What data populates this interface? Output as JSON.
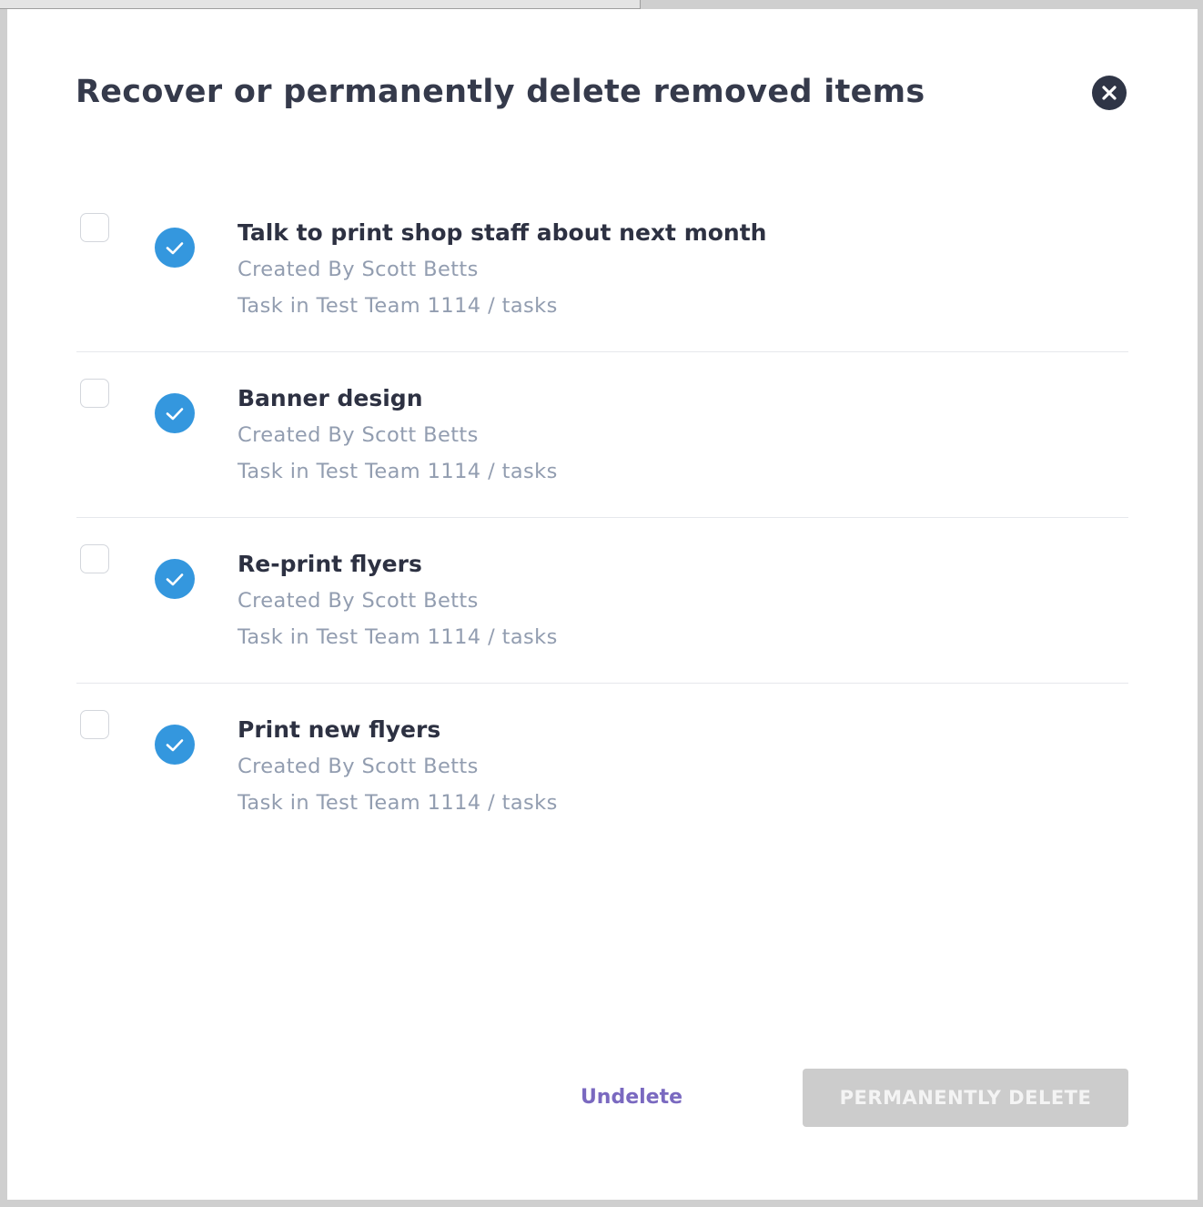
{
  "dialog": {
    "title": "Recover or permanently delete removed items",
    "close_icon": "close-icon"
  },
  "items": [
    {
      "title": "Talk to print shop staff about next month",
      "created_by": "Created By Scott Betts",
      "location": "Task in Test Team 1114 / tasks",
      "selected": false,
      "status": "completed"
    },
    {
      "title": "Banner design",
      "created_by": "Created By Scott Betts",
      "location": "Task in Test Team 1114 / tasks",
      "selected": false,
      "status": "completed"
    },
    {
      "title": "Re-print flyers",
      "created_by": "Created By Scott Betts",
      "location": "Task in Test Team 1114 / tasks",
      "selected": false,
      "status": "completed"
    },
    {
      "title": "Print new flyers",
      "created_by": "Created By Scott Betts",
      "location": "Task in Test Team 1114 / tasks",
      "selected": false,
      "status": "completed"
    }
  ],
  "actions": {
    "undelete_label": "Undelete",
    "permanently_delete_label": "PERMANENTLY DELETE",
    "permanently_delete_enabled": false
  },
  "colors": {
    "title": "#353a4b",
    "meta_text": "#929db0",
    "status_completed": "#3497de",
    "undelete": "#7a69c0",
    "disabled_button": "#cccccc"
  }
}
